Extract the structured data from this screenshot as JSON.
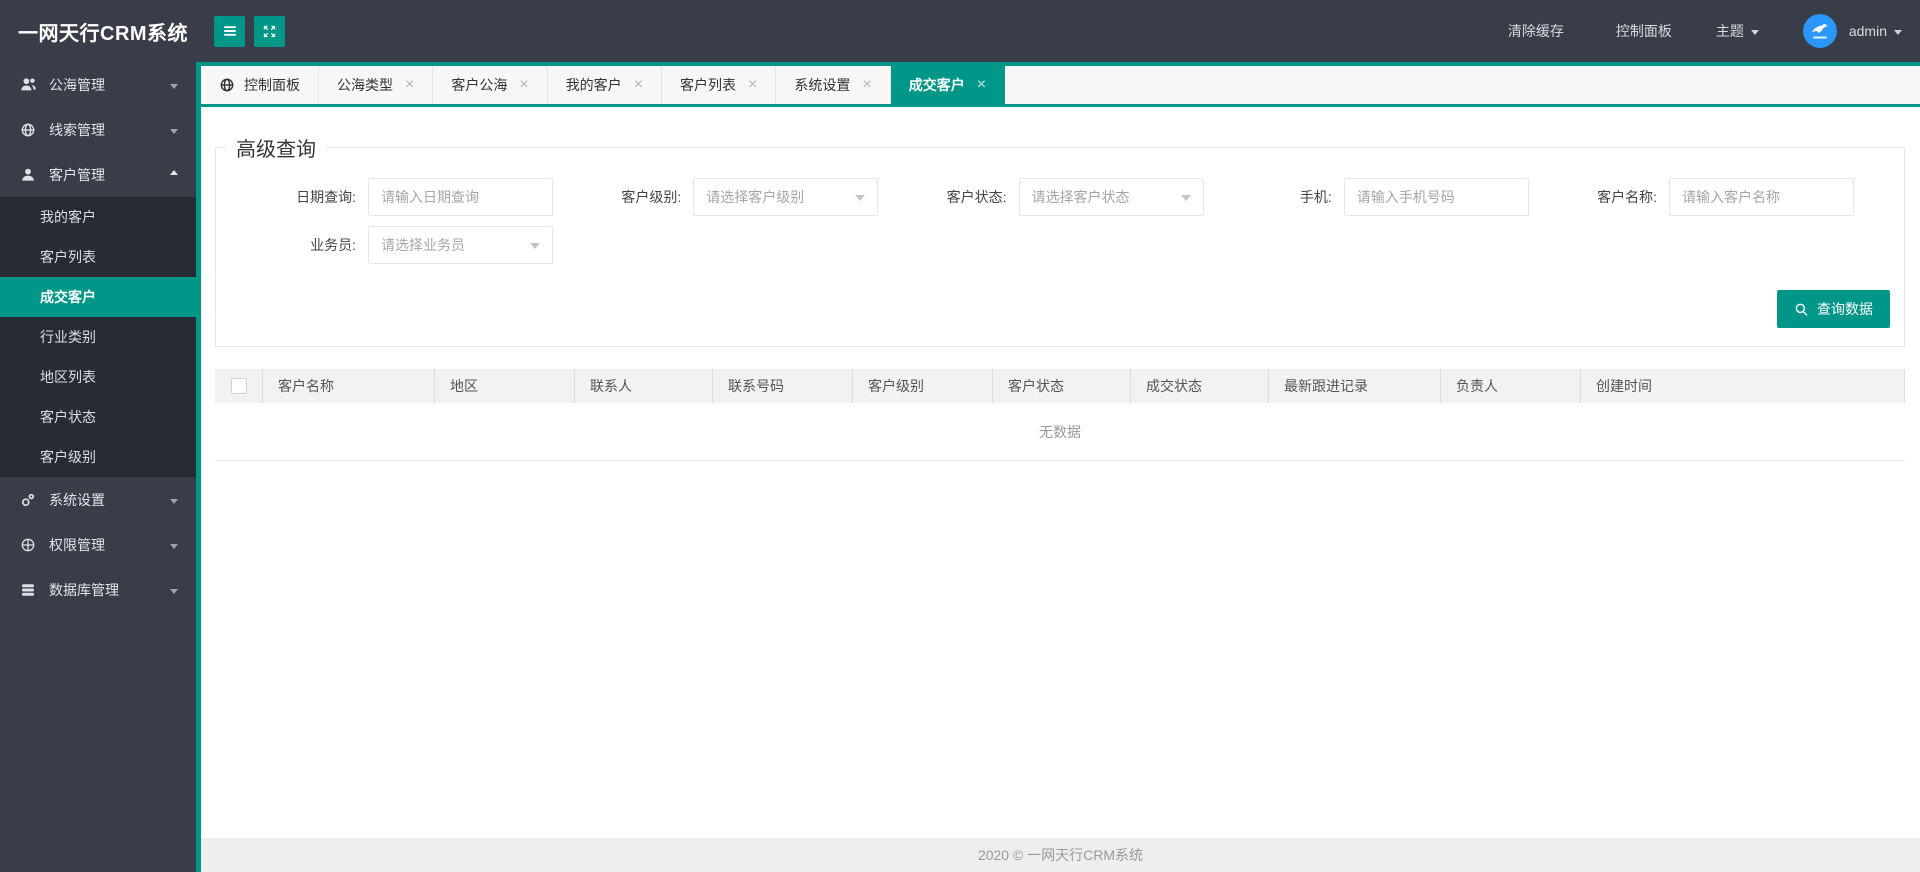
{
  "app": {
    "title": "一网天行CRM系统"
  },
  "header": {
    "clear_cache": "清除缓存",
    "control_panel": "控制面板",
    "theme": "主题",
    "username": "admin"
  },
  "sidebar": {
    "items": [
      {
        "id": "pool-management",
        "label": "公海管理",
        "icon": "users-icon",
        "state": "collapsed"
      },
      {
        "id": "leads-management",
        "label": "线索管理",
        "icon": "globe-icon",
        "state": "collapsed"
      },
      {
        "id": "customer-management",
        "label": "客户管理",
        "icon": "user-icon",
        "state": "expanded",
        "children": [
          {
            "id": "my-customers",
            "label": "我的客户",
            "active": false
          },
          {
            "id": "customer-list",
            "label": "客户列表",
            "active": false
          },
          {
            "id": "deal-customers",
            "label": "成交客户",
            "active": true
          },
          {
            "id": "industry-category",
            "label": "行业类别",
            "active": false
          },
          {
            "id": "region-list",
            "label": "地区列表",
            "active": false
          },
          {
            "id": "customer-status",
            "label": "客户状态",
            "active": false
          },
          {
            "id": "customer-level",
            "label": "客户级别",
            "active": false
          }
        ]
      },
      {
        "id": "system-settings",
        "label": "系统设置",
        "icon": "settings-icon",
        "state": "collapsed"
      },
      {
        "id": "permission-management",
        "label": "权限管理",
        "icon": "permission-icon",
        "state": "collapsed"
      },
      {
        "id": "database-management",
        "label": "数据库管理",
        "icon": "database-icon",
        "state": "collapsed"
      }
    ]
  },
  "tabs": [
    {
      "id": "control-panel",
      "label": "控制面板",
      "icon": "globe-icon",
      "closable": false,
      "active": false
    },
    {
      "id": "pool-type",
      "label": "公海类型",
      "closable": true,
      "active": false
    },
    {
      "id": "customer-pool",
      "label": "客户公海",
      "closable": true,
      "active": false
    },
    {
      "id": "my-customers",
      "label": "我的客户",
      "closable": true,
      "active": false
    },
    {
      "id": "customer-list",
      "label": "客户列表",
      "closable": true,
      "active": false
    },
    {
      "id": "system-settings",
      "label": "系统设置",
      "closable": true,
      "active": false
    },
    {
      "id": "deal-customers",
      "label": "成交客户",
      "closable": true,
      "active": true
    }
  ],
  "query": {
    "legend": "高级查询",
    "fields": [
      {
        "id": "date-query",
        "label": "日期查询:",
        "type": "input",
        "placeholder": "请输入日期查询",
        "row": 1
      },
      {
        "id": "customer-level",
        "label": "客户级别:",
        "type": "select",
        "placeholder": "请选择客户级别",
        "row": 1
      },
      {
        "id": "customer-status",
        "label": "客户状态:",
        "type": "select",
        "placeholder": "请选择客户状态",
        "row": 1
      },
      {
        "id": "mobile",
        "label": "手机:",
        "type": "input",
        "placeholder": "请输入手机号码",
        "row": 1
      },
      {
        "id": "customer-name",
        "label": "客户名称:",
        "type": "input",
        "placeholder": "请输入客户名称",
        "row": 1
      },
      {
        "id": "salesman",
        "label": "业务员:",
        "type": "select",
        "placeholder": "请选择业务员",
        "row": 2
      }
    ],
    "submit_label": "查询数据"
  },
  "table": {
    "columns": [
      "客户名称",
      "地区",
      "联系人",
      "联系号码",
      "客户级别",
      "客户状态",
      "成交状态",
      "最新跟进记录",
      "负责人",
      "创建时间"
    ],
    "empty_text": "无数据"
  },
  "footer": {
    "text": "2020 ©  一网天行CRM系统"
  },
  "colors": {
    "accent": "#009688",
    "header_bg": "#393d49",
    "submenu_bg": "#282b33",
    "avatar_blue": "#2a97ff"
  }
}
